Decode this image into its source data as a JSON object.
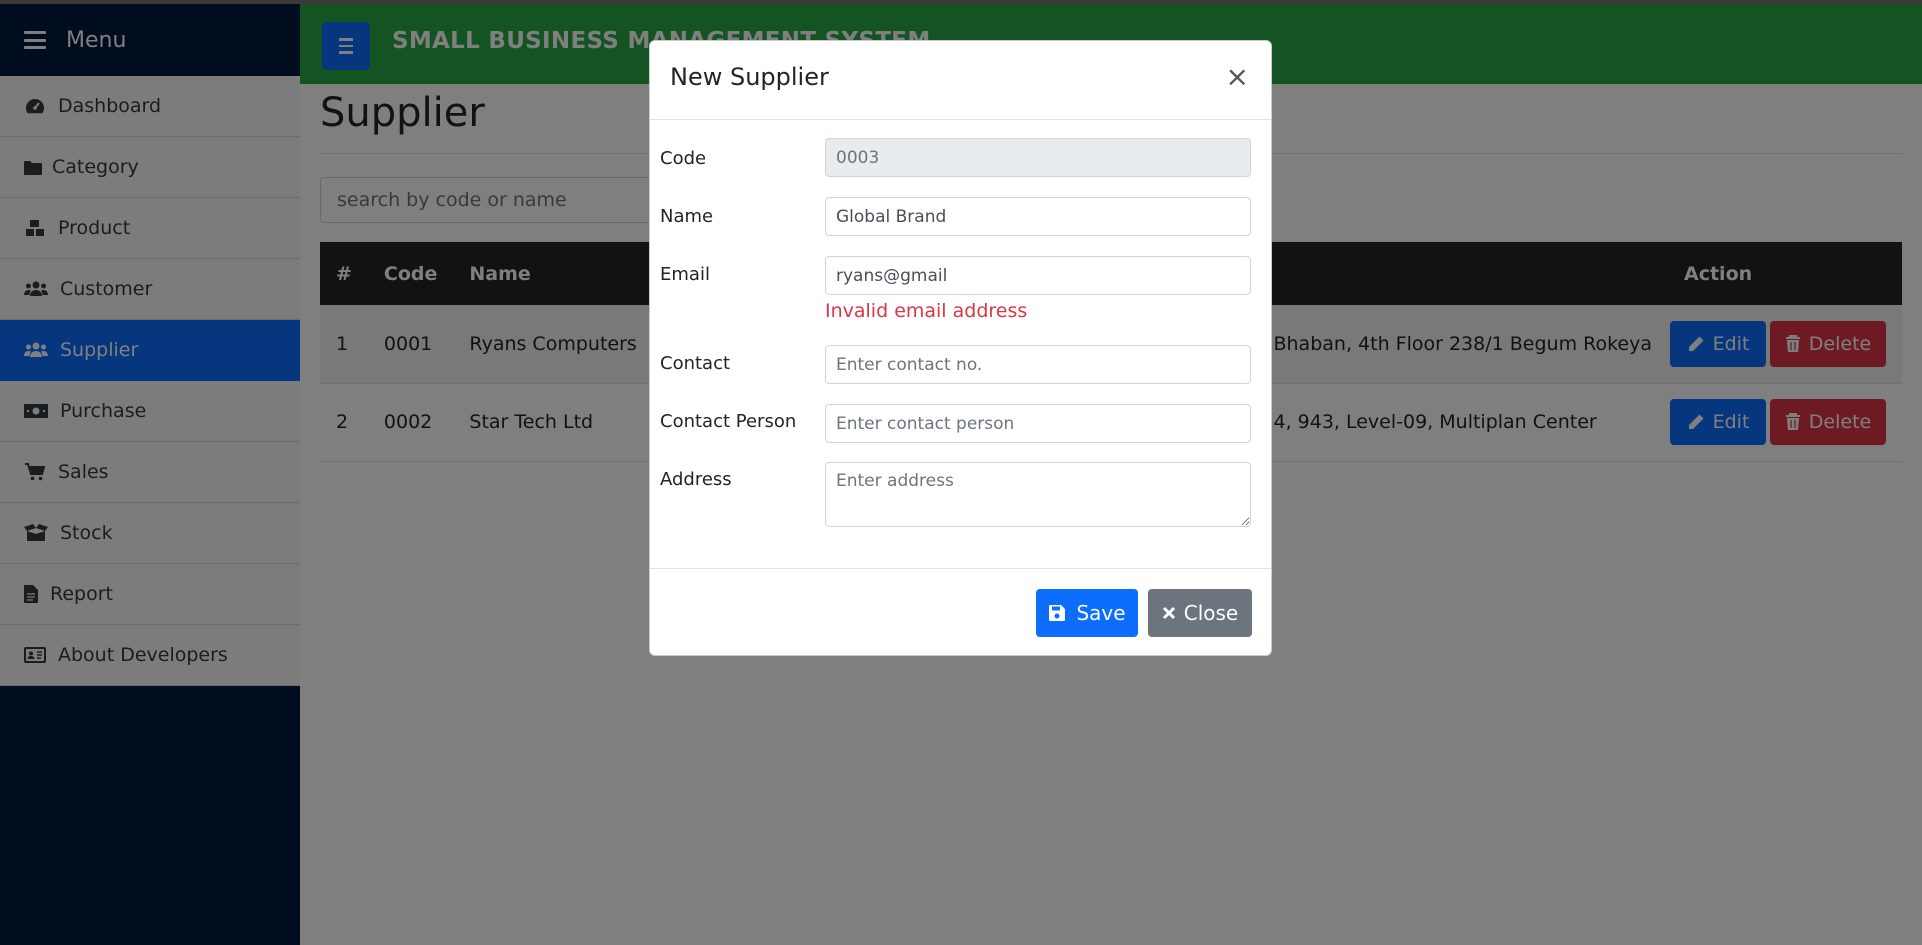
{
  "sidebar": {
    "title": "Menu",
    "items": [
      {
        "label": "Dashboard",
        "icon": "dashboard-icon"
      },
      {
        "label": "Category",
        "icon": "folder-icon"
      },
      {
        "label": "Product",
        "icon": "boxes-icon"
      },
      {
        "label": "Customer",
        "icon": "users-icon"
      },
      {
        "label": "Supplier",
        "icon": "users-icon",
        "active": true
      },
      {
        "label": "Purchase",
        "icon": "money-icon"
      },
      {
        "label": "Sales",
        "icon": "cart-icon"
      },
      {
        "label": "Stock",
        "icon": "box-open-icon"
      },
      {
        "label": "Report",
        "icon": "file-icon"
      },
      {
        "label": "About Developers",
        "icon": "id-card-icon"
      }
    ]
  },
  "navbar": {
    "brand": "SMALL BUSINESS MANAGEMENT SYSTEM"
  },
  "page": {
    "title": "Supplier",
    "search_placeholder": "search by code or name"
  },
  "table": {
    "headers": [
      "#",
      "Code",
      "Name",
      "Action"
    ],
    "rows": [
      {
        "num": "1",
        "code": "0001",
        "name": "Ryans Computers",
        "address": "Bhaban, 4th Floor 238/1 Begum Rokeya"
      },
      {
        "num": "2",
        "code": "0002",
        "name": "Star Tech Ltd",
        "address": "4, 943, Level-09, Multiplan Center"
      }
    ],
    "edit_label": "Edit",
    "delete_label": "Delete"
  },
  "modal": {
    "title": "New Supplier",
    "close_symbol": "×",
    "fields": {
      "code": {
        "label": "Code",
        "value": "0003"
      },
      "name": {
        "label": "Name",
        "value": "Global Brand"
      },
      "email": {
        "label": "Email",
        "value": "ryans@gmail",
        "error": "Invalid email address"
      },
      "contact": {
        "label": "Contact",
        "placeholder": "Enter contact no."
      },
      "contact_person": {
        "label": "Contact Person",
        "placeholder": "Enter contact person"
      },
      "address": {
        "label": "Address",
        "placeholder": "Enter address"
      }
    },
    "save_label": "Save",
    "close_label": "Close"
  },
  "colors": {
    "sidebar_bg": "#001a3d",
    "navbar_bg": "#28a745",
    "primary": "#0d6efd",
    "danger": "#dc3545",
    "secondary": "#6c757d"
  }
}
